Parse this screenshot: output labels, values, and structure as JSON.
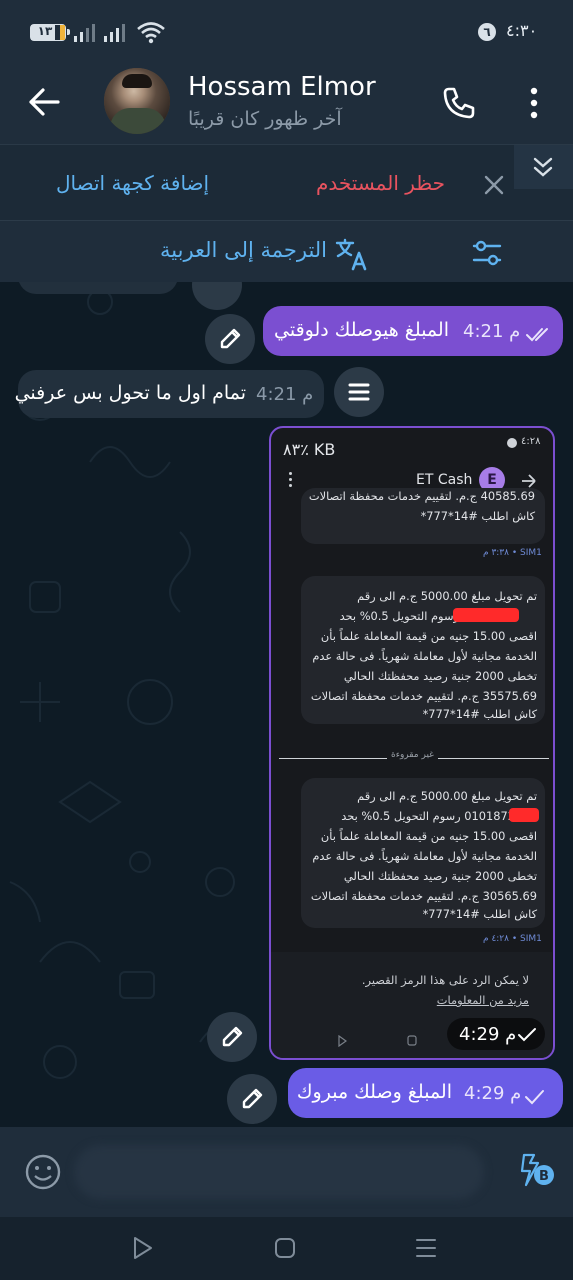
{
  "status_bar": {
    "time": "٤:٣٠",
    "notification_count": "٦",
    "battery": "١٣"
  },
  "header": {
    "name": "Hossam Elmor",
    "last_seen": "آخر ظهور كان قريبًا",
    "icons": [
      "back-arrow-icon",
      "avatar",
      "phone-icon",
      "more-vertical-icon"
    ]
  },
  "contact_bar": {
    "block_label": "حظر المستخدم",
    "add_contact_label": "إضافة كجهة اتصال",
    "colors": {
      "block": "#e8535f",
      "add": "#5fb2ef"
    }
  },
  "translate_bar": {
    "label": "الترجمة إلى العربية"
  },
  "messages": [
    {
      "text": "المبلغ هيوصلك دلوقتي",
      "time": "4:21 م",
      "direction": "out"
    },
    {
      "text": "تمام اول ما تحول بس عرفني",
      "time": "4:21 م",
      "direction": "in"
    },
    {
      "text": "المبلغ وصلك مبروك",
      "time": "4:29 م",
      "direction": "out"
    }
  ],
  "image_message": {
    "time": "4:29 م",
    "screenshot": {
      "status_time": "٤:٢٨",
      "status_left": "٨٣٪ KB",
      "title": "ET Cash",
      "avatar_letter": "E",
      "top_card_lines": [
        "40585.69 ج.م. لتقييم خدمات محفظة اتصالات",
        "كاش اطلب #14*777*"
      ],
      "sim_label_1": "٣:٣٨ م • SIM1",
      "card1_lines": [
        "تم تحويل مبلغ 5000.00 ج.م الى رقم",
        "رسوم التحويل 0.5% بحد",
        "اقصى 15.00 جنيه من قيمة المعاملة علماً بأن",
        "الخدمة مجانية لأول معاملة شهرياً. فى حالة عدم",
        "تخطى 2000 جنية رصيد محفظتك الحالي",
        "35575.69 ج.م. لتقييم خدمات محفظة اتصالات",
        "كاش اطلب #14*777*"
      ],
      "unread_divider": "غير مقروءة",
      "card2_lines": [
        "تم تحويل مبلغ 5000.00 ج.م الى رقم",
        "0101872 رسوم التحويل 0.5% بحد",
        "اقصى 15.00 جنيه من قيمة المعاملة علماً بأن",
        "الخدمة مجانية لأول معاملة شهرياً. فى حالة عدم",
        "تخطى 2000 جنية رصيد محفظتك الحالي",
        "30565.69 ج.م. لتقييم خدمات محفظة اتصالات",
        "كاش اطلب #14*777*"
      ],
      "sim_label_2": "٤:٢٨ م • SIM1",
      "footer_text": "لا يمكن الرد على هذا الرمز القصير.",
      "footer_link": "مزيد من المعلومات"
    }
  },
  "input_bar": {
    "icons": [
      "emoji-icon",
      "bot-icon"
    ]
  },
  "nav_bar": {
    "icons": [
      "back-triangle-icon",
      "home-square-icon",
      "recents-icon"
    ]
  }
}
